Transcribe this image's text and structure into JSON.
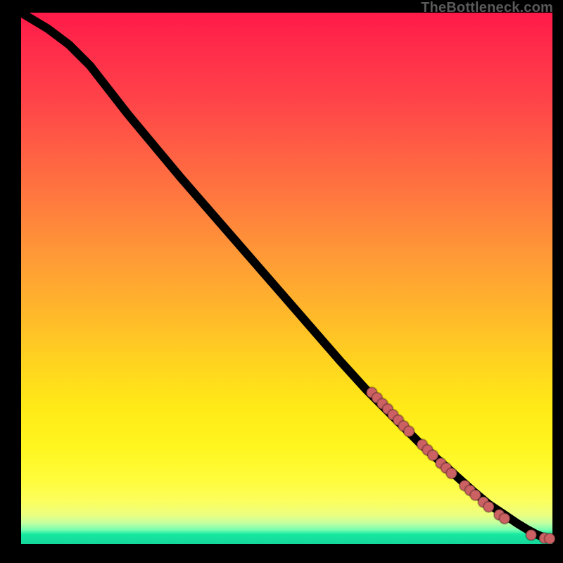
{
  "watermark": "TheBottleneck.com",
  "colors": {
    "marker_fill": "#cc6163",
    "curve_stroke": "#000000",
    "frame_bg": "#000000"
  },
  "chart_data": {
    "type": "line",
    "title": "",
    "xlabel": "",
    "ylabel": "",
    "xlim": [
      0,
      100
    ],
    "ylim": [
      0,
      100
    ],
    "note": "Axes unlabeled in source image; values below are normalized 0–100 estimates read from pixel positions. y is percent height from bottom (green) to top (red).",
    "series": [
      {
        "name": "curve",
        "x": [
          0,
          5,
          9,
          13,
          20,
          30,
          40,
          50,
          60,
          65,
          70,
          75,
          80,
          85,
          88,
          91,
          93.5,
          95.5,
          97,
          98.5,
          100
        ],
        "y": [
          100,
          97,
          94,
          90,
          81,
          69,
          57.5,
          46,
          34.5,
          29,
          24,
          19,
          14.5,
          10,
          7.5,
          5.5,
          3.8,
          2.6,
          1.8,
          1.2,
          1.0
        ]
      }
    ],
    "markers": {
      "name": "highlighted-points",
      "points": [
        {
          "x": 66.0,
          "y": 28.5
        },
        {
          "x": 67.0,
          "y": 27.5
        },
        {
          "x": 68.0,
          "y": 26.4
        },
        {
          "x": 69.0,
          "y": 25.4
        },
        {
          "x": 70.0,
          "y": 24.3
        },
        {
          "x": 71.0,
          "y": 23.3
        },
        {
          "x": 72.0,
          "y": 22.2
        },
        {
          "x": 73.0,
          "y": 21.2
        },
        {
          "x": 75.5,
          "y": 18.7
        },
        {
          "x": 76.5,
          "y": 17.7
        },
        {
          "x": 77.5,
          "y": 16.7
        },
        {
          "x": 79.0,
          "y": 15.2
        },
        {
          "x": 80.0,
          "y": 14.3
        },
        {
          "x": 81.0,
          "y": 13.3
        },
        {
          "x": 83.5,
          "y": 11.0
        },
        {
          "x": 84.5,
          "y": 10.1
        },
        {
          "x": 85.5,
          "y": 9.2
        },
        {
          "x": 87.0,
          "y": 7.9
        },
        {
          "x": 88.0,
          "y": 7.0
        },
        {
          "x": 90.0,
          "y": 5.5
        },
        {
          "x": 91.0,
          "y": 4.8
        },
        {
          "x": 96.0,
          "y": 1.7
        },
        {
          "x": 98.5,
          "y": 1.1
        },
        {
          "x": 99.5,
          "y": 1.0
        }
      ]
    }
  }
}
